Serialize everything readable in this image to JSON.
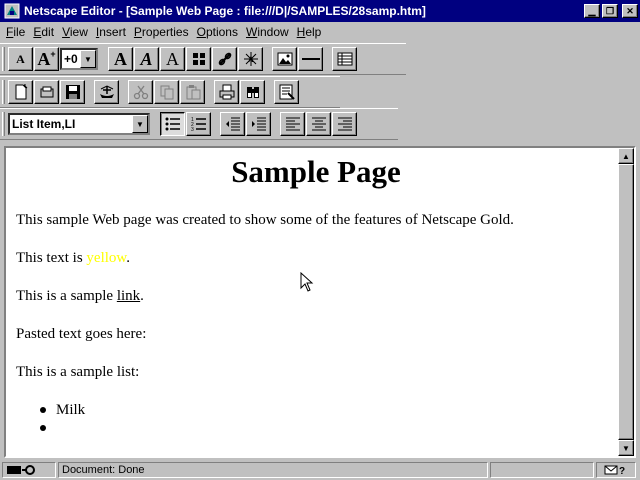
{
  "window": {
    "title": "Netscape Editor - [Sample Web Page : file:///D|/SAMPLES/28samp.htm]"
  },
  "menu": [
    {
      "label": "File",
      "key": "F",
      "rest": "ile"
    },
    {
      "label": "Edit",
      "key": "E",
      "rest": "dit"
    },
    {
      "label": "View",
      "key": "V",
      "rest": "iew"
    },
    {
      "label": "Insert",
      "key": "I",
      "rest": "nsert"
    },
    {
      "label": "Properties",
      "key": "P",
      "rest": "roperties"
    },
    {
      "label": "Options",
      "key": "O",
      "rest": "ptions"
    },
    {
      "label": "Window",
      "key": "W",
      "rest": "indow"
    },
    {
      "label": "Help",
      "key": "H",
      "rest": "elp"
    }
  ],
  "format_toolbar": {
    "font_size": "+0",
    "glyph_decrease": "A",
    "glyph_increase": "A",
    "glyph_bold": "A",
    "glyph_italic": "A",
    "glyph_fixed": "A"
  },
  "paragraph_toolbar": {
    "style": "List Item,LI"
  },
  "document": {
    "heading": "Sample Page",
    "intro": "This sample Web page was created to show some of the features of Netscape Gold.",
    "yellow_prefix": "This text is ",
    "yellow_word": "yellow",
    "yellow_suffix": ".",
    "link_prefix": "This is a sample ",
    "link_word": "link",
    "link_suffix": ".",
    "pasted": "Pasted text goes here:",
    "list_intro": "This is a sample list:",
    "list_items": [
      "Milk",
      ""
    ]
  },
  "status": {
    "text": "Document: Done"
  },
  "colors": {
    "titlebar": "#000080",
    "face": "#c0c0c0",
    "yellow_text": "#ffff00"
  }
}
